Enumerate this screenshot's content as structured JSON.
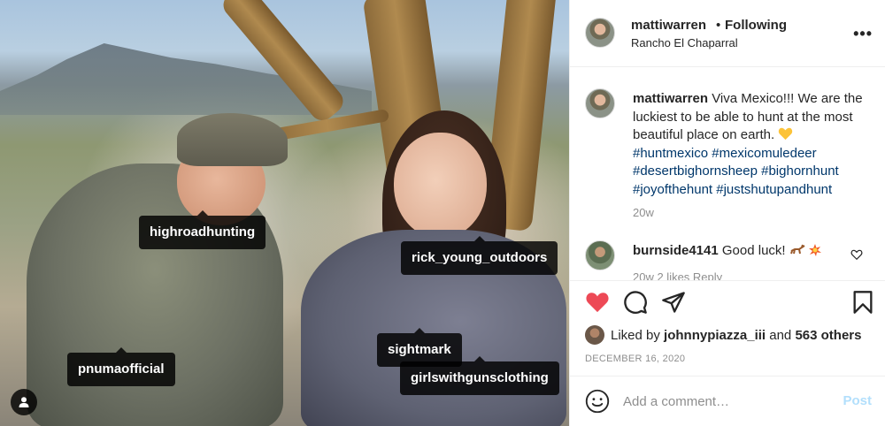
{
  "photo": {
    "tags": [
      {
        "label": "highroadhunting"
      },
      {
        "label": "rick_young_outdoors"
      },
      {
        "label": "sightmark"
      },
      {
        "label": "pnumaofficial"
      },
      {
        "label": "girlswithgunsclothing"
      }
    ],
    "user_tag_icon": "user-icon"
  },
  "header": {
    "username": "mattiwarren",
    "separator": "•",
    "follow_status": "Following",
    "location": "Rancho El Chaparral",
    "more_icon": "more-icon"
  },
  "caption": {
    "username": "mattiwarren",
    "text": "Viva Mexico!!! We are the luckiest to be able to hunt at the most beautiful place on earth.",
    "emoji": "yellow-heart",
    "hashtags": [
      "#huntmexico",
      "#mexicomuledeer",
      "#desertbighornsheep",
      "#bighornhunt",
      "#joyofthehunt",
      "#justshutupandhunt"
    ],
    "age": "20w"
  },
  "comments": [
    {
      "username": "burnside4141",
      "text": "Good luck!",
      "emoji": "deer-and-collision",
      "partial_line": "20w  2 likes  Reply"
    }
  ],
  "actions": {
    "like_icon": "heart-filled-icon",
    "comment_icon": "comment-icon",
    "share_icon": "share-icon",
    "save_icon": "bookmark-icon",
    "like_color": "#ed4956"
  },
  "likes": {
    "prefix": "Liked by",
    "user": "johnnypiazza_iii",
    "joiner": "and",
    "others": "563 others"
  },
  "date": "DECEMBER 16, 2020",
  "add_comment": {
    "placeholder": "Add a comment…",
    "post_label": "Post",
    "emoji_icon": "emoji-icon"
  }
}
